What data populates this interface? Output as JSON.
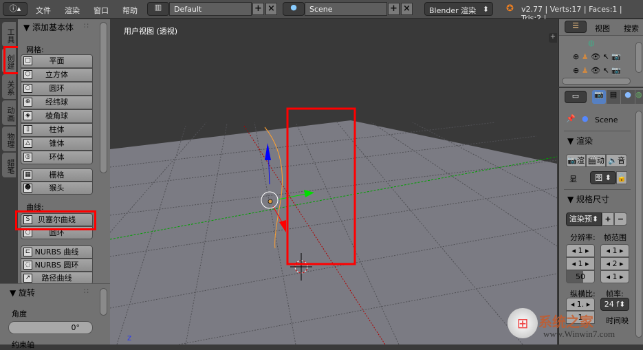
{
  "header": {
    "menus": [
      "文件",
      "渲染",
      "窗口",
      "帮助"
    ],
    "layout": "Default",
    "scene": "Scene",
    "engine": "Blender 渲染",
    "stats": "v2.77 | Verts:17 | Faces:1 | Tris:2 |"
  },
  "tabs": [
    "工具",
    "创建",
    "关系",
    "动画",
    "物理",
    "蜡笔"
  ],
  "tool": {
    "panel_title": "添加基本体",
    "mesh_label": "网格:",
    "mesh": [
      "平面",
      "立方体",
      "圆环",
      "经纬球",
      "棱角球",
      "柱体",
      "锥体",
      "环体"
    ],
    "mesh2": [
      "栅格",
      "猴头"
    ],
    "curve_label": "曲线:",
    "curve": [
      "贝塞尔曲线",
      "圆环"
    ],
    "nurbs": [
      "NURBS 曲线",
      "NURBS 圆环",
      "路径曲线"
    ],
    "rot_title": "旋转",
    "angle_label": "角度",
    "angle_value": "0°",
    "axis_label": "约束轴"
  },
  "viewport": {
    "title": "用户视图 (透视)",
    "axis_z": "Z"
  },
  "outliner": {
    "view": "视图",
    "search": "搜索"
  },
  "props": {
    "scene": "Scene",
    "render_title": "渲染",
    "render_btns": [
      "渲",
      "动",
      "音"
    ],
    "display_label": "显",
    "display_value": "图",
    "dims_title": "规格尺寸",
    "preset": "渲染预",
    "res_label": "分辨率:",
    "range_label": "帧范围",
    "res": [
      "1",
      "1",
      "50"
    ],
    "range": [
      "1",
      "2",
      "1"
    ],
    "aspect_label": "纵横比:",
    "fps_label": "帧率:",
    "aspect": [
      "1.",
      "1"
    ],
    "fps": "24 f",
    "time_label": "时间映"
  },
  "watermark": {
    "brand": "系统之家",
    "url": "www.Winwin7.com"
  },
  "colors": {
    "highlight": "#ff0000",
    "x_axis": "#ff0000",
    "y_axis": "#00cc00",
    "z_axis": "#0000ff",
    "curve": "#ffa030"
  }
}
